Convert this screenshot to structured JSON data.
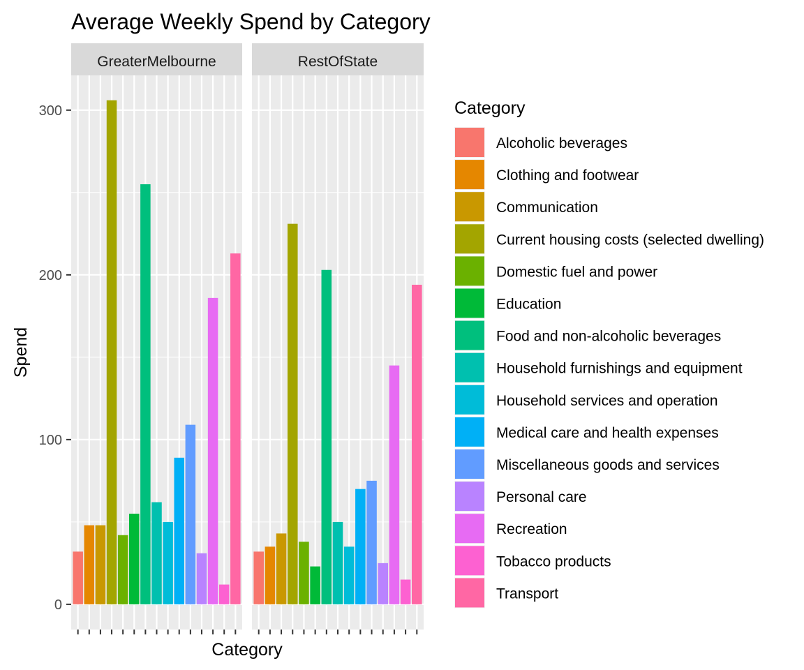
{
  "chart_data": {
    "type": "bar",
    "title": "Average Weekly Spend by Category",
    "xlabel": "Category",
    "ylabel": "Spend",
    "ylim": [
      -15.3,
      321.1
    ],
    "yticks": [
      0,
      100,
      200,
      300
    ],
    "grid": true,
    "legend": {
      "title": "Category",
      "placement": "right"
    },
    "categories": [
      "Alcoholic beverages",
      "Clothing and footwear",
      "Communication",
      "Current housing costs (selected dwelling)",
      "Domestic fuel and power",
      "Education",
      "Food and non-alcoholic beverages",
      "Household furnishings and equipment",
      "Household services and operation",
      "Medical care and health expenses",
      "Miscellaneous goods and services",
      "Personal care",
      "Recreation",
      "Tobacco products",
      "Transport"
    ],
    "colors": [
      "#F8766D",
      "#E58700",
      "#C99800",
      "#A3A500",
      "#6BB100",
      "#00BA38",
      "#00BF7D",
      "#00C0AF",
      "#00BCD8",
      "#00B0F6",
      "#619CFF",
      "#B983FF",
      "#E76BF3",
      "#FD61D1",
      "#FF67A4"
    ],
    "facets": [
      {
        "name": "GreaterMelbourne",
        "values": [
          32,
          48,
          48,
          306,
          42,
          55,
          255,
          62,
          50,
          89,
          109,
          31,
          186,
          12,
          213
        ]
      },
      {
        "name": "RestOfState",
        "values": [
          32,
          35,
          43,
          231,
          38,
          23,
          203,
          50,
          35,
          70,
          75,
          25,
          145,
          15,
          194
        ]
      }
    ]
  }
}
